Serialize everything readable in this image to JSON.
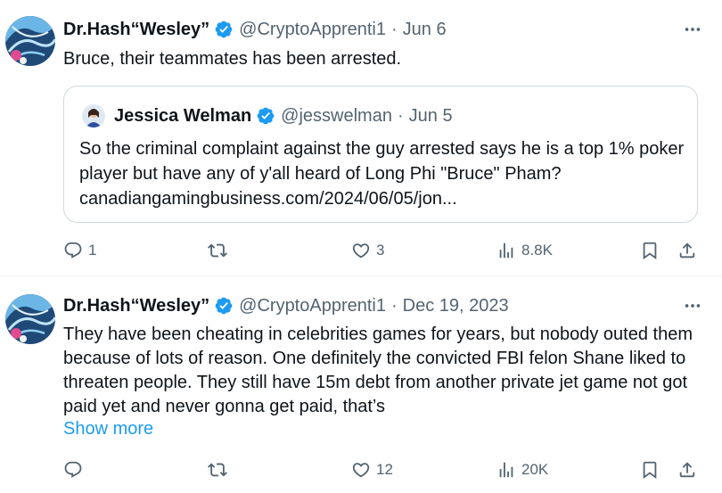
{
  "tweets": [
    {
      "author_name": "Dr.Hash“Wesley”",
      "handle": "@CryptoApprenti1",
      "separator": "·",
      "date": "Jun 6",
      "text": "Bruce, their teammates has been arrested.",
      "quote": {
        "author_name": "Jessica Welman",
        "handle": "@jesswelman",
        "separator": "·",
        "date": "Jun 5",
        "text": "So the criminal complaint against the guy arrested says he is a top 1% poker player but have any of y'all heard of Long Phi \"Bruce\" Pham? canadiangamingbusiness.com/2024/06/05/jon..."
      },
      "replies": "1",
      "reposts": "",
      "likes": "3",
      "views": "8.8K"
    },
    {
      "author_name": "Dr.Hash“Wesley”",
      "handle": "@CryptoApprenti1",
      "separator": "·",
      "date": "Dec 19, 2023",
      "text": "They have been cheating in celebrities games for years, but nobody outed them because of lots of reason. One definitely the convicted FBI felon Shane liked to threaten people. They still have 15m debt from another private jet game not got paid yet and never gonna get paid, that’s",
      "show_more": "Show more",
      "replies": "",
      "reposts": "",
      "likes": "12",
      "views": "20K"
    }
  ],
  "colors": {
    "text": "#0f1419",
    "secondary": "#536471",
    "link": "#1d9bf0",
    "verified": "#1d9bf0",
    "border": "#cfd9de"
  },
  "icons": [
    "more-icon",
    "verified-badge-icon",
    "reply-icon",
    "repost-icon",
    "like-icon",
    "views-icon",
    "bookmark-icon",
    "share-icon"
  ]
}
